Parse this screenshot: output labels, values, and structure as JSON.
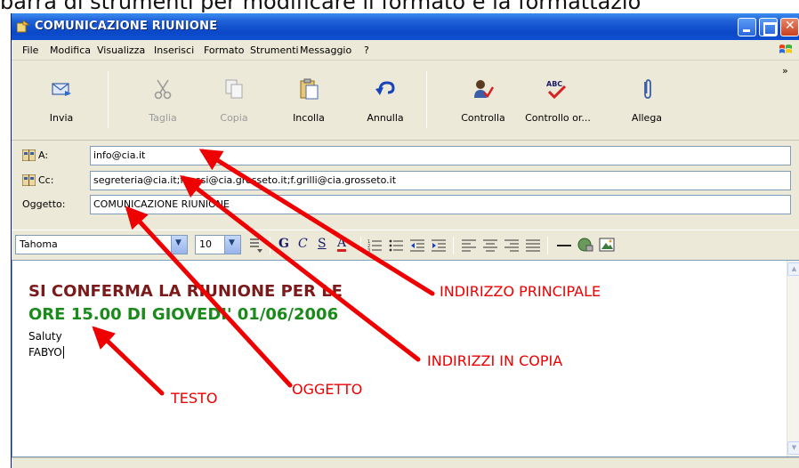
{
  "caption": "barra di strumenti per modificare il formato e la formattazio",
  "window": {
    "title": "COMUNICAZIONE RIUNIONE"
  },
  "menu": [
    "File",
    "Modifica",
    "Visualizza",
    "Inserisci",
    "Formato",
    "Strumenti",
    "Messaggio",
    "?"
  ],
  "toolbar": {
    "overflow": "»",
    "buttons": [
      {
        "label": "Invia",
        "icon": "send-icon",
        "enabled": true
      },
      {
        "label": "Taglia",
        "icon": "scissors-icon",
        "enabled": false
      },
      {
        "label": "Copia",
        "icon": "copy-icon",
        "enabled": false
      },
      {
        "label": "Incolla",
        "icon": "paste-icon",
        "enabled": true
      },
      {
        "label": "Annulla",
        "icon": "undo-icon",
        "enabled": true
      },
      {
        "label": "Controlla",
        "icon": "check-names-icon",
        "enabled": true
      },
      {
        "label": "Controllo or...",
        "icon": "spellcheck-icon",
        "enabled": true
      },
      {
        "label": "Allega",
        "icon": "paperclip-icon",
        "enabled": true
      }
    ]
  },
  "fields": {
    "to": {
      "label": "A:",
      "value": "info@cia.it"
    },
    "cc": {
      "label": "Cc:",
      "value": "segreteria@cia.it;f.rossi@cia.grosseto.it;f.grilli@cia.grosseto.it"
    },
    "subject": {
      "label": "Oggetto:",
      "value": "COMUNICAZIONE RIUNIONE"
    }
  },
  "format": {
    "font": "Tahoma",
    "size": "10",
    "bold": "G",
    "italic": "C",
    "underline": "S",
    "font_color": "A"
  },
  "message": {
    "line1": "SI CONFERMA LA RIUNIONE PER LE",
    "line2": "ORE 15.00 DI GIOVEDI' 01/06/2006",
    "line3": "Saluty",
    "line4": "FABYO",
    "color1": "#7a1a1a",
    "color2": "#1a8a1a"
  },
  "annotations": {
    "to": "INDIRIZZO PRINCIPALE",
    "cc": "INDIRIZZI IN COPIA",
    "subject": "OGGETTO",
    "body": "TESTO",
    "color": "#ee0000"
  }
}
